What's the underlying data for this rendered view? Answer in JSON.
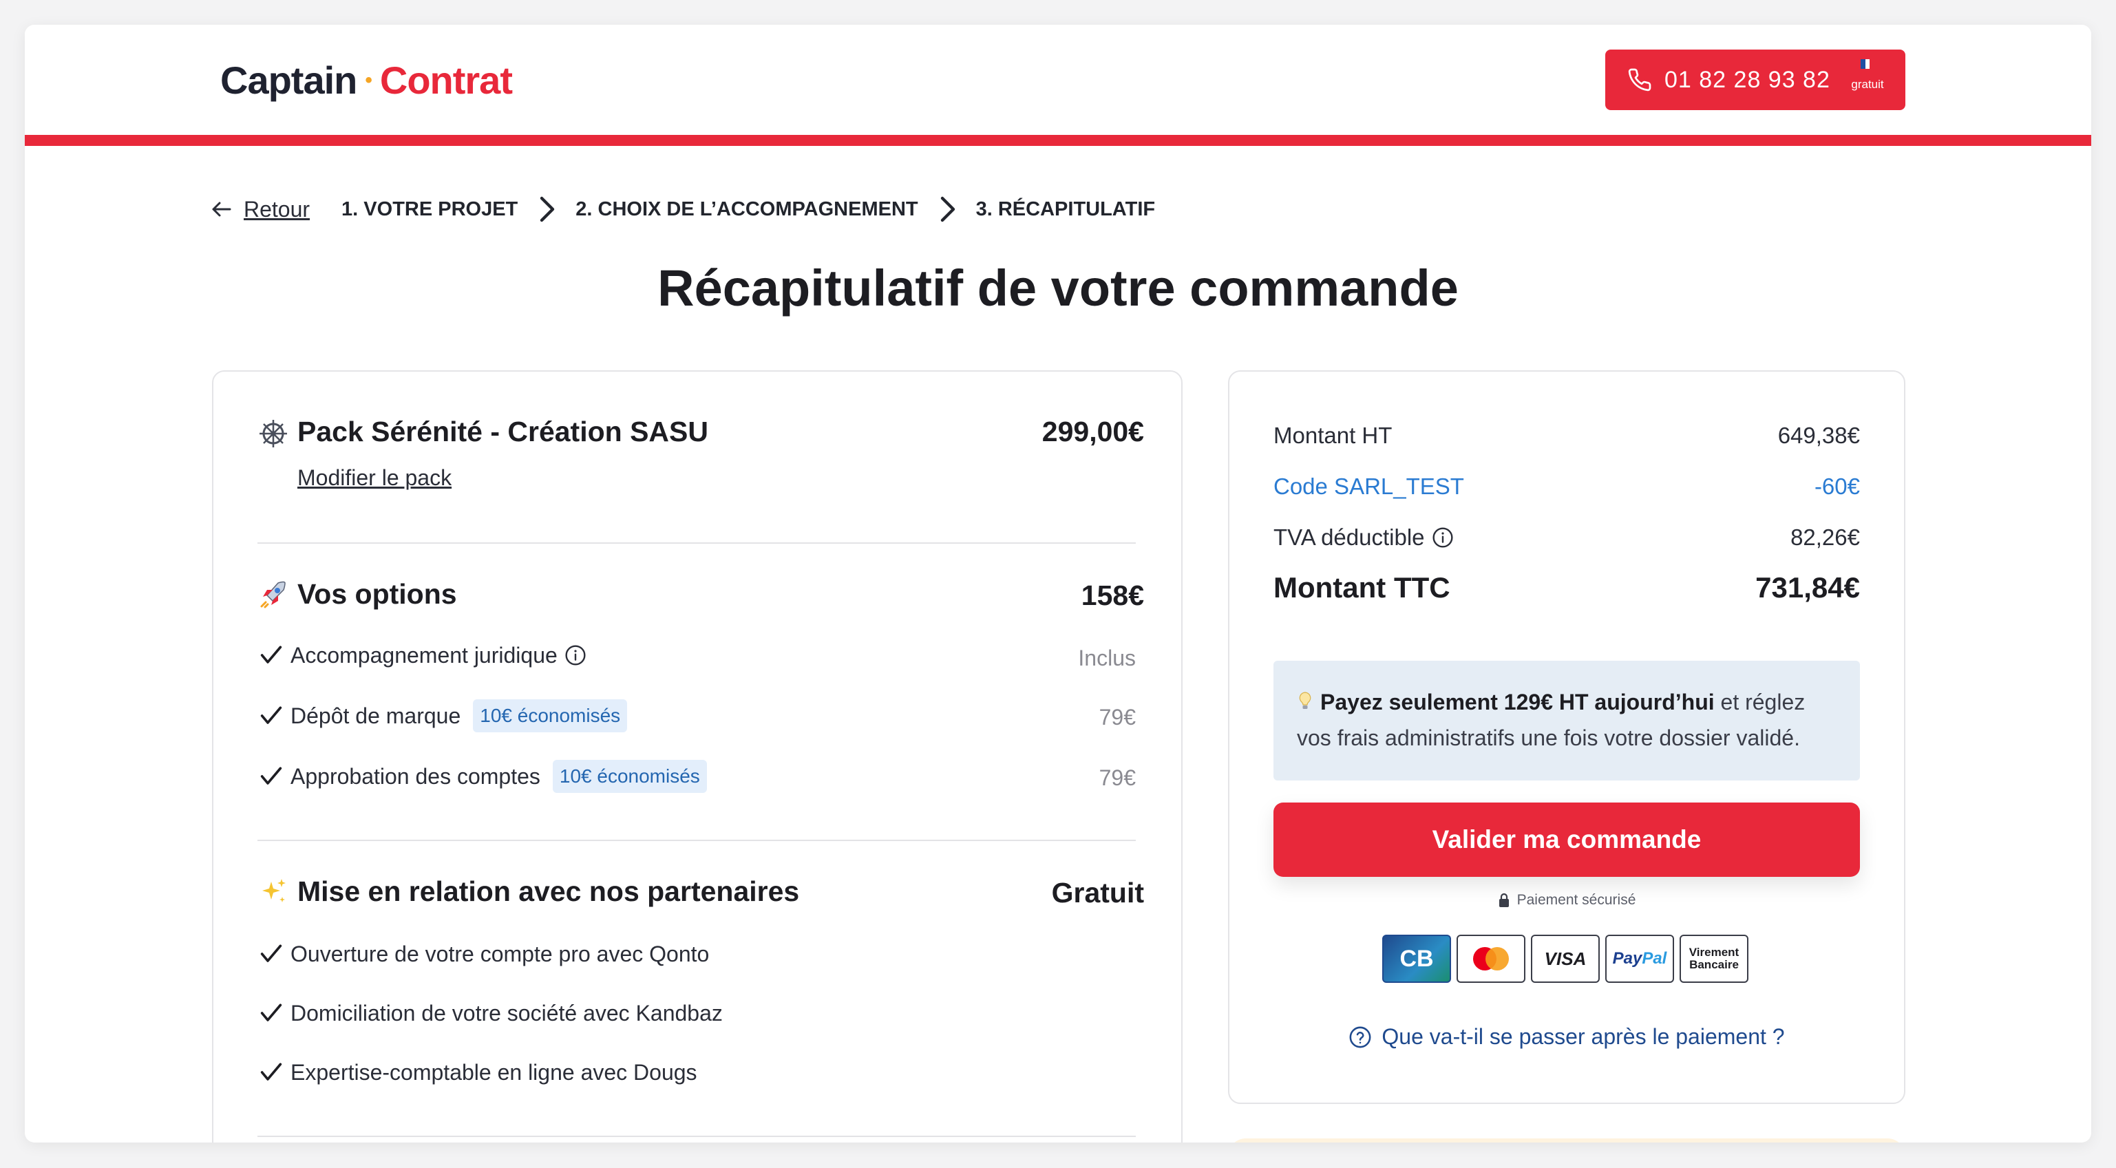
{
  "header": {
    "logo_part1": "Captain",
    "logo_dot": "•",
    "logo_part2": "Contrat",
    "phone_number": "01 82 28 93 82",
    "phone_free_label": "gratuit",
    "accent_color": "#e8283a"
  },
  "breadcrumb": {
    "back_label": "Retour",
    "steps": [
      "1. VOTRE PROJET",
      "2. CHOIX DE L’ACCOMPAGNEMENT",
      "3. RÉCAPITULATIF"
    ]
  },
  "page_title": "Récapitulatif de votre commande",
  "pack": {
    "title": "Pack Sérénité - Création SASU",
    "price": "299,00€",
    "modify_label": "Modifier le pack",
    "icon": "ship-wheel-icon"
  },
  "options": {
    "title": "Vos options",
    "total": "158€",
    "icon": "rocket-icon",
    "items": [
      {
        "label": "Accompagnement juridique",
        "badge": "",
        "price": "Inclus"
      },
      {
        "label": "Dépôt de marque",
        "badge": "10€ économisés",
        "price": "79€"
      },
      {
        "label": "Approbation des comptes",
        "badge": "10€ économisés",
        "price": "79€"
      }
    ]
  },
  "partners": {
    "title": "Mise en relation avec nos partenaires",
    "price": "Gratuit",
    "icon": "sparkles-icon",
    "items": [
      "Ouverture de votre compte pro avec Qonto",
      "Domiciliation de votre société avec Kandbaz",
      "Expertise-comptable en ligne avec Dougs"
    ]
  },
  "summary": {
    "ht_label": "Montant HT",
    "ht_value": "649,38€",
    "code_label": "Code SARL_TEST",
    "code_value": "-60€",
    "tva_label": "TVA déductible",
    "tva_value": "82,26€",
    "ttc_label": "Montant TTC",
    "ttc_value": "731,84€",
    "notice_bold": "Payez seulement 129€ HT aujourd’hui",
    "notice_rest": " et réglez vos frais administratifs une fois votre dossier validé.",
    "cta_label": "Valider ma commande",
    "secure_label": "Paiement sécurisé",
    "payment_methods": {
      "cb": "CB",
      "visa": "VISA",
      "paypal_a": "Pay",
      "paypal_b": "Pal",
      "virement_1": "Virement",
      "virement_2": "Bancaire"
    },
    "help_label": "Que va-t-il se passer après le paiement ?"
  }
}
